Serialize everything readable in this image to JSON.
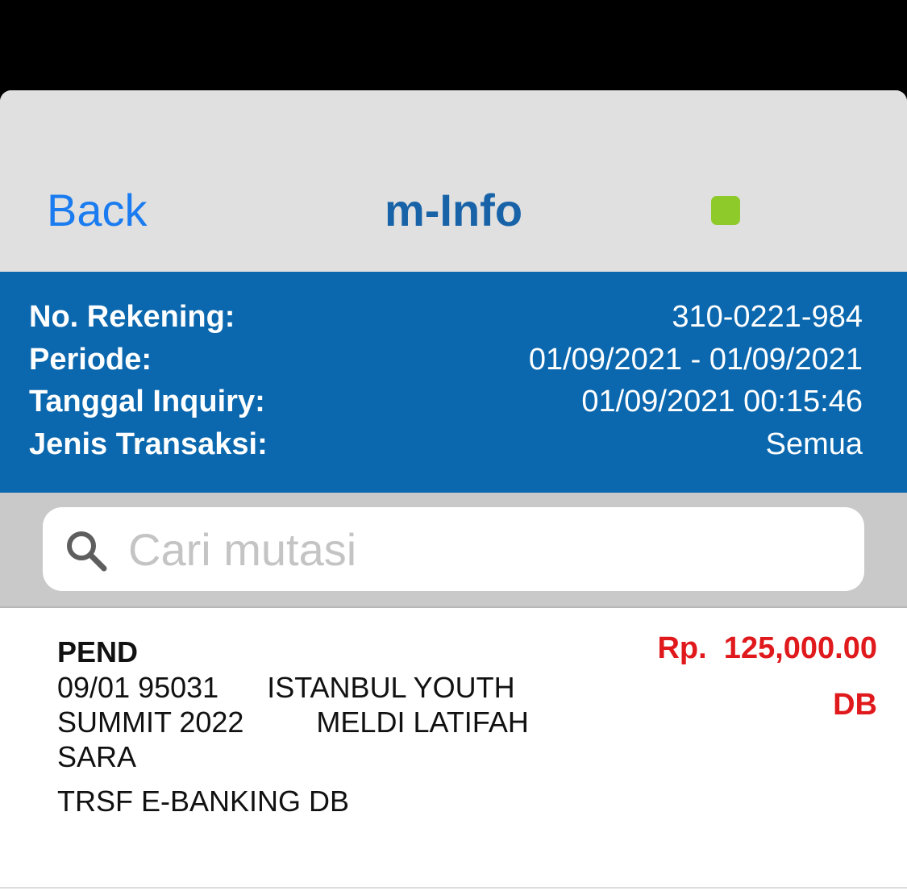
{
  "app": {
    "background_color": "#000000"
  },
  "navbar": {
    "back_label": "Back",
    "title": "m-Info",
    "status_color": "#8fca2b"
  },
  "account_info": {
    "rows": [
      {
        "label": "No. Rekening:",
        "value": "310-0221-984"
      },
      {
        "label": "Periode:",
        "value": "01/09/2021 - 01/09/2021"
      },
      {
        "label": "Tanggal Inquiry:",
        "value": "01/09/2021 00:15:46"
      },
      {
        "label": "Jenis Transaksi:",
        "value": "Semua"
      }
    ],
    "background_color": "#0b68ae"
  },
  "search": {
    "placeholder": "Cari mutasi",
    "value": "",
    "icon": "search-icon"
  },
  "transactions": [
    {
      "type": "PEND",
      "description": "09/01 95031      ISTANBUL YOUTH\nSUMMIT 2022         MELDI LATIFAH\nSARA",
      "code": "TRSF E-BANKING DB",
      "amount": "Rp.  125,000.00",
      "dc": "DB",
      "amount_color": "#e0191d"
    }
  ]
}
